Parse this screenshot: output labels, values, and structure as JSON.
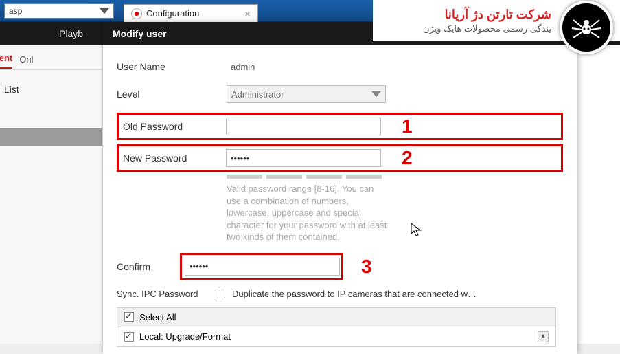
{
  "browser": {
    "address": "asp",
    "tab_title": "Configuration"
  },
  "brand": {
    "title": "شرکت تارتن دژ آریانا",
    "sub": "یندگی رسمی محصولات هایک ویژن"
  },
  "nav": {
    "playback": "Playb",
    "tab_red": "gement",
    "tab_grey": "Onl",
    "list": "List"
  },
  "dialog": {
    "title": "Modify user",
    "username_label": "User Name",
    "username_value": "admin",
    "level_label": "Level",
    "level_value": "Administrator",
    "oldpw_label": "Old Password",
    "oldpw_value": "",
    "newpw_label": "New Password",
    "newpw_value": "••••••",
    "confirm_label": "Confirm",
    "confirm_value": "••••••",
    "hint": "Valid password range [8-16]. You can use a combination of numbers, lowercase, uppercase and special character for your password with at least two kinds of them contained.",
    "sync_label": "Sync. IPC Password",
    "sync_desc": "Duplicate the password to IP cameras that are connected w…",
    "select_all": "Select All",
    "perm_local": "Local: Upgrade/Format"
  },
  "annotations": {
    "n1": "1",
    "n2": "2",
    "n3": "3"
  }
}
